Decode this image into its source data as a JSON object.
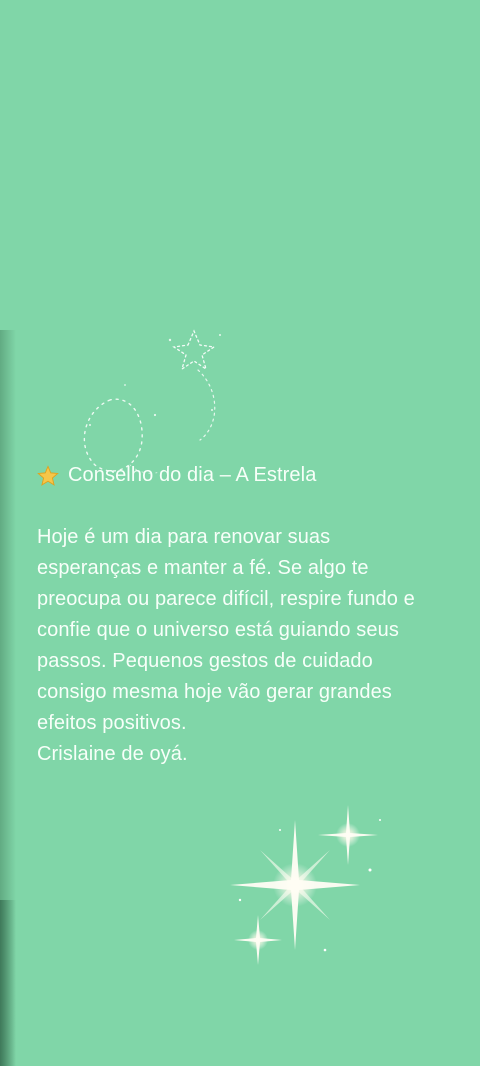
{
  "post": {
    "title": "Conselho do dia – A Estrela",
    "title_icon": "star-emoji",
    "lines": [
      "Hoje é um dia para renovar suas",
      "esperanças e manter a fé. Se algo te",
      "preocupa ou parece difícil, respire fundo e",
      "confie que o universo está guiando seus",
      "passos. Pequenos gestos de cuidado",
      "consigo mesma hoje vão gerar grandes",
      "efeitos positivos."
    ],
    "signature": "Crislaine de oyá."
  },
  "colors": {
    "background": "#80d6a8",
    "text": "#f7fff9"
  },
  "decorations": [
    "sparkle-doodle",
    "glitter-sparkles"
  ]
}
